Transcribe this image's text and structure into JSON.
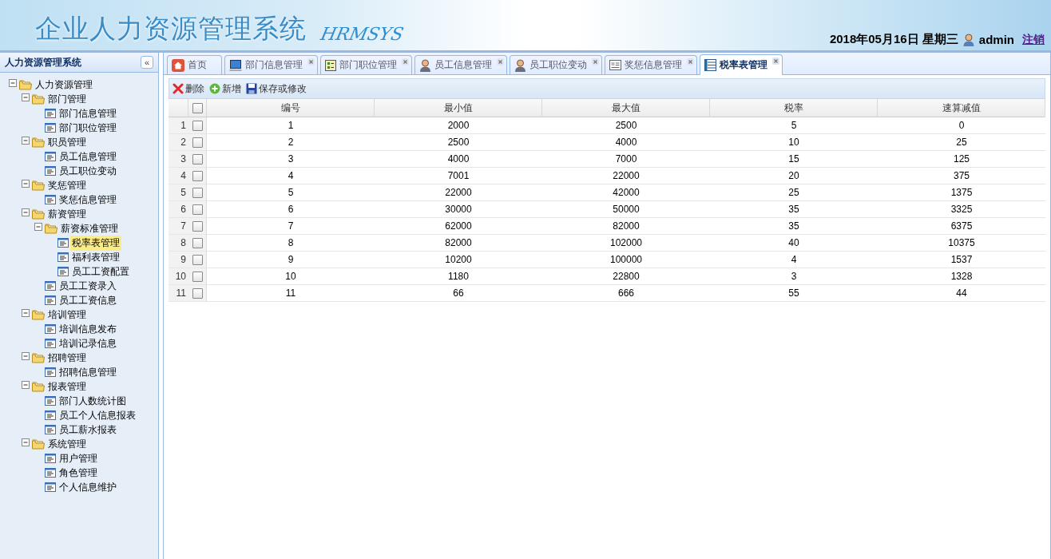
{
  "header": {
    "title": "企业人力资源管理系统",
    "subtitle": "HRMSYS",
    "date": "2018年05月16日 星期三",
    "user": "admin",
    "logout": "注销"
  },
  "sidebar": {
    "title": "人力资源管理系统",
    "collapse": "«",
    "tree": [
      {
        "label": "人力资源管理",
        "selected": false,
        "expanded": true,
        "children": [
          {
            "label": "部门管理",
            "selected": false,
            "expanded": true,
            "children": [
              {
                "label": "部门信息管理",
                "selected": false
              },
              {
                "label": "部门职位管理",
                "selected": false
              }
            ]
          },
          {
            "label": "职员管理",
            "selected": false,
            "expanded": true,
            "children": [
              {
                "label": "员工信息管理",
                "selected": false
              },
              {
                "label": "员工职位变动",
                "selected": false
              }
            ]
          },
          {
            "label": "奖惩管理",
            "selected": false,
            "expanded": true,
            "children": [
              {
                "label": "奖惩信息管理",
                "selected": false
              }
            ]
          },
          {
            "label": "薪资管理",
            "selected": false,
            "expanded": true,
            "children": [
              {
                "label": "薪资标准管理",
                "selected": false,
                "expanded": true,
                "children": [
                  {
                    "label": "税率表管理",
                    "selected": true
                  },
                  {
                    "label": "福利表管理",
                    "selected": false
                  },
                  {
                    "label": "员工工资配置",
                    "selected": false
                  }
                ]
              },
              {
                "label": "员工工资录入",
                "selected": false
              },
              {
                "label": "员工工资信息",
                "selected": false
              }
            ]
          },
          {
            "label": "培训管理",
            "selected": false,
            "expanded": true,
            "children": [
              {
                "label": "培训信息发布",
                "selected": false
              },
              {
                "label": "培训记录信息",
                "selected": false
              }
            ]
          },
          {
            "label": "招聘管理",
            "selected": false,
            "expanded": true,
            "children": [
              {
                "label": "招聘信息管理",
                "selected": false
              }
            ]
          },
          {
            "label": "报表管理",
            "selected": false,
            "expanded": true,
            "children": [
              {
                "label": "部门人数统计图",
                "selected": false
              },
              {
                "label": "员工个人信息报表",
                "selected": false
              },
              {
                "label": "员工薪水报表",
                "selected": false
              }
            ]
          },
          {
            "label": "系统管理",
            "selected": false,
            "expanded": true,
            "children": [
              {
                "label": "用户管理",
                "selected": false
              },
              {
                "label": "角色管理",
                "selected": false
              },
              {
                "label": "个人信息维护",
                "selected": false
              }
            ]
          }
        ]
      }
    ]
  },
  "tabs": [
    {
      "label": "首页",
      "kind": "home",
      "closable": false,
      "selected": false
    },
    {
      "label": "部门信息管理",
      "kind": "monitor",
      "closable": true,
      "selected": false
    },
    {
      "label": "部门职位管理",
      "kind": "grid",
      "closable": true,
      "selected": false
    },
    {
      "label": "员工信息管理",
      "kind": "person",
      "closable": true,
      "selected": false
    },
    {
      "label": "员工职位变动",
      "kind": "person",
      "closable": true,
      "selected": false
    },
    {
      "label": "奖惩信息管理",
      "kind": "form",
      "closable": true,
      "selected": false
    },
    {
      "label": "税率表管理",
      "kind": "table",
      "closable": true,
      "selected": true
    }
  ],
  "toolbar": [
    {
      "label": "删除",
      "kind": "delete"
    },
    {
      "label": "新增",
      "kind": "add"
    },
    {
      "label": "保存或修改",
      "kind": "save"
    }
  ],
  "table": {
    "columns": [
      "编号",
      "最小值",
      "最大值",
      "税率",
      "速算减值"
    ],
    "header_checked": false,
    "rows": [
      {
        "index": "1",
        "checked": false,
        "cells": [
          "1",
          "2000",
          "2500",
          "5",
          "0"
        ]
      },
      {
        "index": "2",
        "checked": false,
        "cells": [
          "2",
          "2500",
          "4000",
          "10",
          "25"
        ]
      },
      {
        "index": "3",
        "checked": false,
        "cells": [
          "3",
          "4000",
          "7000",
          "15",
          "125"
        ]
      },
      {
        "index": "4",
        "checked": false,
        "cells": [
          "4",
          "7001",
          "22000",
          "20",
          "375"
        ]
      },
      {
        "index": "5",
        "checked": false,
        "cells": [
          "5",
          "22000",
          "42000",
          "25",
          "1375"
        ]
      },
      {
        "index": "6",
        "checked": false,
        "cells": [
          "6",
          "30000",
          "50000",
          "35",
          "3325"
        ]
      },
      {
        "index": "7",
        "checked": false,
        "cells": [
          "7",
          "62000",
          "82000",
          "35",
          "6375"
        ]
      },
      {
        "index": "8",
        "checked": false,
        "cells": [
          "8",
          "82000",
          "102000",
          "40",
          "10375"
        ]
      },
      {
        "index": "9",
        "checked": false,
        "cells": [
          "9",
          "10200",
          "100000",
          "4",
          "1537"
        ]
      },
      {
        "index": "10",
        "checked": false,
        "cells": [
          "10",
          "1180",
          "22800",
          "3",
          "1328"
        ]
      },
      {
        "index": "11",
        "checked": false,
        "cells": [
          "11",
          "66",
          "666",
          "55",
          "44"
        ]
      }
    ]
  }
}
